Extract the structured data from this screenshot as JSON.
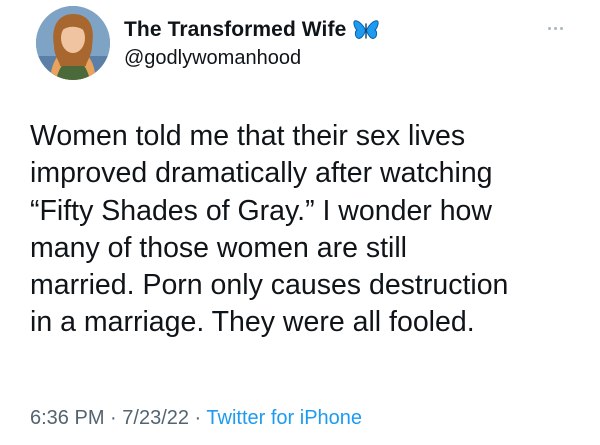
{
  "author": {
    "display_name": "The Transformed Wife",
    "verified_emoji_icon": "butterfly-icon",
    "handle": "@godlywomanhood"
  },
  "tweet": {
    "lines": [
      "Women told me that their sex lives",
      "improved dramatically after watching",
      "“Fifty Shades of Gray.” I wonder how",
      "many of those women are still",
      "married. Porn only causes destruction",
      "in a marriage. They were all fooled."
    ]
  },
  "meta": {
    "time": "6:36 PM",
    "separator": " · ",
    "date": "7/23/22",
    "separator2": " · ",
    "source": "Twitter for iPhone"
  },
  "colors": {
    "text": "#0f1419",
    "secondary": "#536471",
    "link": "#1d9bf0",
    "butterfly": "#1d9bf0"
  }
}
